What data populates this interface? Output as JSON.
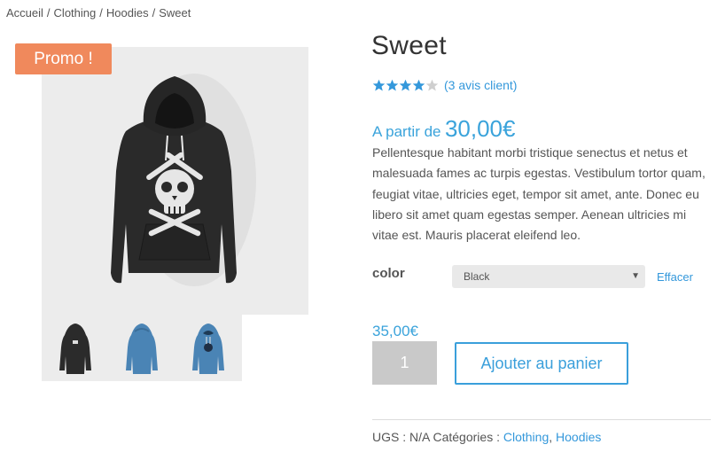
{
  "breadcrumb": {
    "items": [
      "Accueil",
      "Clothing",
      "Hoodies",
      "Sweet"
    ],
    "separator": "/"
  },
  "product": {
    "badge": "Promo !",
    "title": "Sweet",
    "rating": {
      "value": 4,
      "max": 5,
      "reviews_label": "(3 avis client)"
    },
    "price_prefix": "A partir de",
    "price_amount": "30,00€",
    "description": "Pellentesque habitant morbi tristique senectus et netus et malesuada fames ac turpis egestas. Vestibulum tortor quam, feugiat vitae, ultricies eget, tempor sit amet, ante. Donec eu libero sit amet quam egestas semper. Aenean ultricies mi vitae est. Mauris placerat eleifend leo.",
    "variation": {
      "label": "color",
      "selected": "Black",
      "clear_label": "Effacer"
    },
    "variation_price": "35,00€",
    "quantity": "1",
    "add_to_cart_label": "Ajouter au panier",
    "meta": {
      "sku_label": "UGS :",
      "sku_value": "N/A",
      "categories_label": "Catégories :",
      "categories": [
        "Clothing",
        "Hoodies"
      ],
      "categories_sep": ","
    },
    "images": {
      "main": "black-hoodie-skull",
      "thumbnails": [
        "black-hoodie-back",
        "blue-hoodie-back",
        "blue-hoodie-front"
      ]
    }
  },
  "colors": {
    "accent": "#3aa3db",
    "badge": "#f0895c",
    "star": "#3498db",
    "star_empty": "#cfcfcf"
  }
}
